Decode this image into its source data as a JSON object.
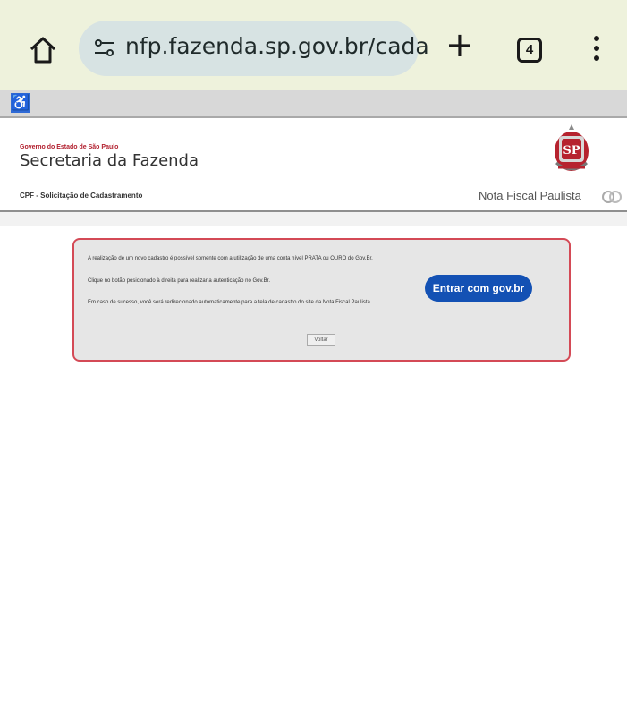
{
  "browser": {
    "url": "nfp.fazenda.sp.gov.br/cada",
    "tab_count": "4",
    "new_tab_symbol": "+",
    "icons": {
      "home": "home-icon",
      "site_info": "site-settings-icon",
      "menu": "more-vert-icon"
    }
  },
  "accessibility": {
    "icon": "wheelchair-icon",
    "glyph": "♿"
  },
  "header": {
    "government": "Governo do Estado de São Paulo",
    "secretaria": "Secretaria da Fazenda",
    "crest_text": "SP"
  },
  "section": {
    "left_title": "CPF - Solicitação de Cadastramento",
    "right_title": "Nota Fiscal Paulista"
  },
  "card": {
    "message_1": "A realização de um novo cadastro é possível somente com a utilização de uma conta nível PRATA ou OURO do Gov.Br.",
    "message_2": "Clique no botão posicionado à direita para realizar a autenticação no Gov.Br.",
    "message_3": "Em caso de sucesso, você será redirecionado automaticamente para a tela de cadastro do site da Nota Fiscal Paulista.",
    "govbr_button": "Entrar com gov.br",
    "back_button": "Voltar"
  },
  "colors": {
    "browser_bg": "#eef2dc",
    "url_pill": "#d7e3e3",
    "govbr_blue": "#1351b4",
    "card_border": "#d44a56",
    "government_red": "#b21f2e"
  }
}
